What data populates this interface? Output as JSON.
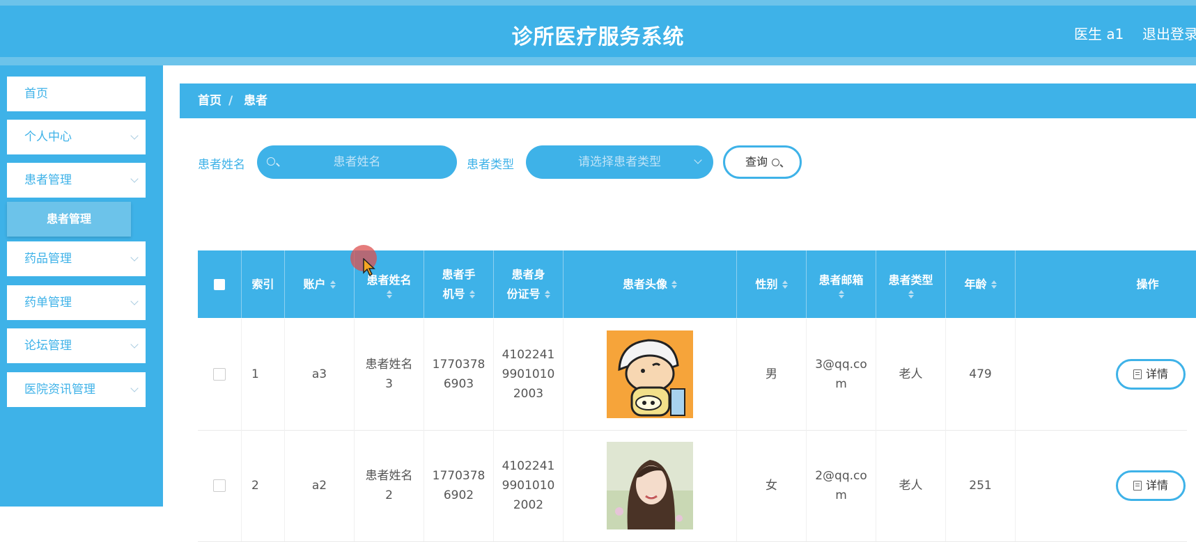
{
  "header": {
    "title": "诊所医疗服务系统",
    "user": "医生 a1",
    "logout": "退出登录"
  },
  "sidebar": {
    "items": [
      {
        "label": "首页"
      },
      {
        "label": "个人中心"
      },
      {
        "label": "患者管理"
      },
      {
        "label": "药品管理"
      },
      {
        "label": "药单管理"
      },
      {
        "label": "论坛管理"
      },
      {
        "label": "医院资讯管理"
      }
    ],
    "active_submenu": "患者管理"
  },
  "breadcrumb": {
    "home": "首页",
    "separator": "/",
    "current": "患者"
  },
  "search": {
    "name_label": "患者姓名",
    "name_placeholder": "患者姓名",
    "type_label": "患者类型",
    "type_placeholder": "请选择患者类型",
    "query_button": "查询"
  },
  "table": {
    "columns": [
      "索引",
      "账户",
      "患者姓名",
      "患者手机号",
      "患者身份证号",
      "患者头像",
      "性别",
      "患者邮箱",
      "患者类型",
      "年龄",
      "操作"
    ],
    "rows": [
      {
        "index": "1",
        "account": "a3",
        "name": "患者姓名3",
        "phone": "17703786903",
        "id_number": "410224199010102003",
        "gender": "男",
        "email": "3@qq.com",
        "type": "老人",
        "age": "479",
        "action": "详情"
      },
      {
        "index": "2",
        "account": "a2",
        "name": "患者姓名2",
        "phone": "17703786902",
        "id_number": "410224199010102002",
        "gender": "女",
        "email": "2@qq.com",
        "type": "老人",
        "age": "251",
        "action": "详情"
      }
    ]
  },
  "colors": {
    "primary": "#3eb2e8",
    "light": "#6cc3ea"
  }
}
